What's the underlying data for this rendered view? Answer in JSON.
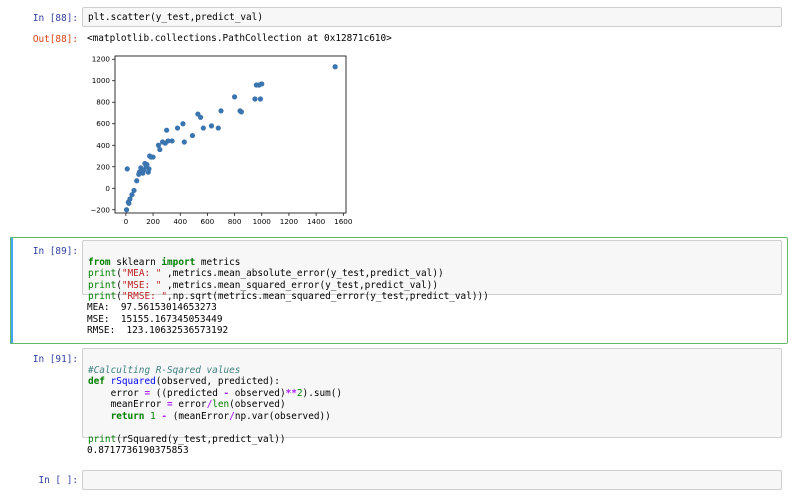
{
  "cells": {
    "c88": {
      "prompt": "In [88]:",
      "code": "plt.scatter(y_test,predict_val)",
      "out_prompt": "Out[88]:",
      "output": "<matplotlib.collections.PathCollection at 0x12871c610>"
    },
    "c89": {
      "prompt": "In [89]:",
      "lines": [
        "from sklearn import metrics",
        "print(\"MEA: \" ,metrics.mean_absolute_error(y_test,predict_val))",
        "print(\"MSE: \" ,metrics.mean_squared_error(y_test,predict_val))",
        "print(\"RMSE: \",np.sqrt(metrics.mean_squared_error(y_test,predict_val)))"
      ],
      "output": [
        "MEA:  97.56153014653273",
        "MSE:  15155.167345053449",
        "RMSE:  123.10632536573192"
      ]
    },
    "c91": {
      "prompt": "In [91]:",
      "lines": [
        "#Calculting R-Sqared values",
        "def rSquared(observed, predicted):",
        "    error = ((predicted - observed)**2).sum()",
        "    meanError = error/len(observed)",
        "    return 1 - (meanError/np.var(observed))",
        "",
        "print(rSquared(y_test,predict_val))"
      ],
      "output": "0.8717736190375853"
    },
    "empty": {
      "prompt": "In [ ]:"
    }
  },
  "colors": {
    "in_prompt": "#303f9f",
    "out_prompt": "#d84315",
    "points": "#3b75af",
    "selected_border": "#66bb6a"
  },
  "chart_data": {
    "type": "scatter",
    "title": "",
    "xlabel": "",
    "ylabel": "",
    "xlim": [
      -80,
      1620
    ],
    "ylim": [
      -230,
      1230
    ],
    "xticks": [
      0,
      200,
      400,
      600,
      800,
      1000,
      1200,
      1400,
      1600
    ],
    "yticks": [
      -200,
      0,
      200,
      400,
      600,
      800,
      1000,
      1200
    ],
    "grid": false,
    "series": [
      {
        "x": [
          5,
          10,
          18,
          22,
          30,
          45,
          60,
          80,
          95,
          100,
          110,
          118,
          125,
          130,
          140,
          150,
          155,
          165,
          170,
          175,
          185,
          200,
          240,
          250,
          270,
          290,
          300,
          310,
          340,
          380,
          420,
          430,
          490,
          530,
          550,
          570,
          630,
          680,
          700,
          800,
          840,
          850,
          950,
          960,
          980,
          990,
          1000,
          1540
        ],
        "y": [
          -200,
          180,
          -130,
          -140,
          -100,
          -60,
          -20,
          70,
          130,
          150,
          190,
          160,
          140,
          170,
          230,
          200,
          220,
          150,
          180,
          300,
          290,
          290,
          400,
          360,
          430,
          420,
          540,
          440,
          440,
          560,
          600,
          430,
          490,
          690,
          660,
          560,
          580,
          560,
          720,
          850,
          720,
          710,
          830,
          960,
          960,
          830,
          970,
          1130
        ]
      }
    ]
  }
}
